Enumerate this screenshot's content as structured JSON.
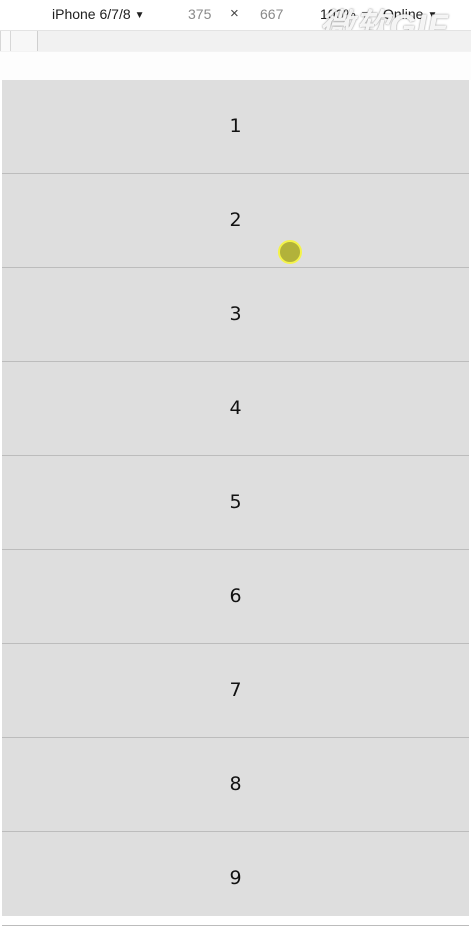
{
  "toolbar": {
    "device": "iPhone 6/7/8",
    "width": "375",
    "times": "×",
    "height": "667",
    "zoom": "100%",
    "network": "Online"
  },
  "watermark": "微软GIF",
  "list": {
    "items": [
      "1",
      "2",
      "3",
      "4",
      "5",
      "6",
      "7",
      "8",
      "9"
    ]
  },
  "colors": {
    "item_bg": "#dedede",
    "divider": "#bcbcbc",
    "cursor_fill": "#b2b23a",
    "cursor_ring": "#f4f34a"
  },
  "icons": {
    "dropdown": "caret-down-icon",
    "cursor": "click-indicator-icon"
  }
}
